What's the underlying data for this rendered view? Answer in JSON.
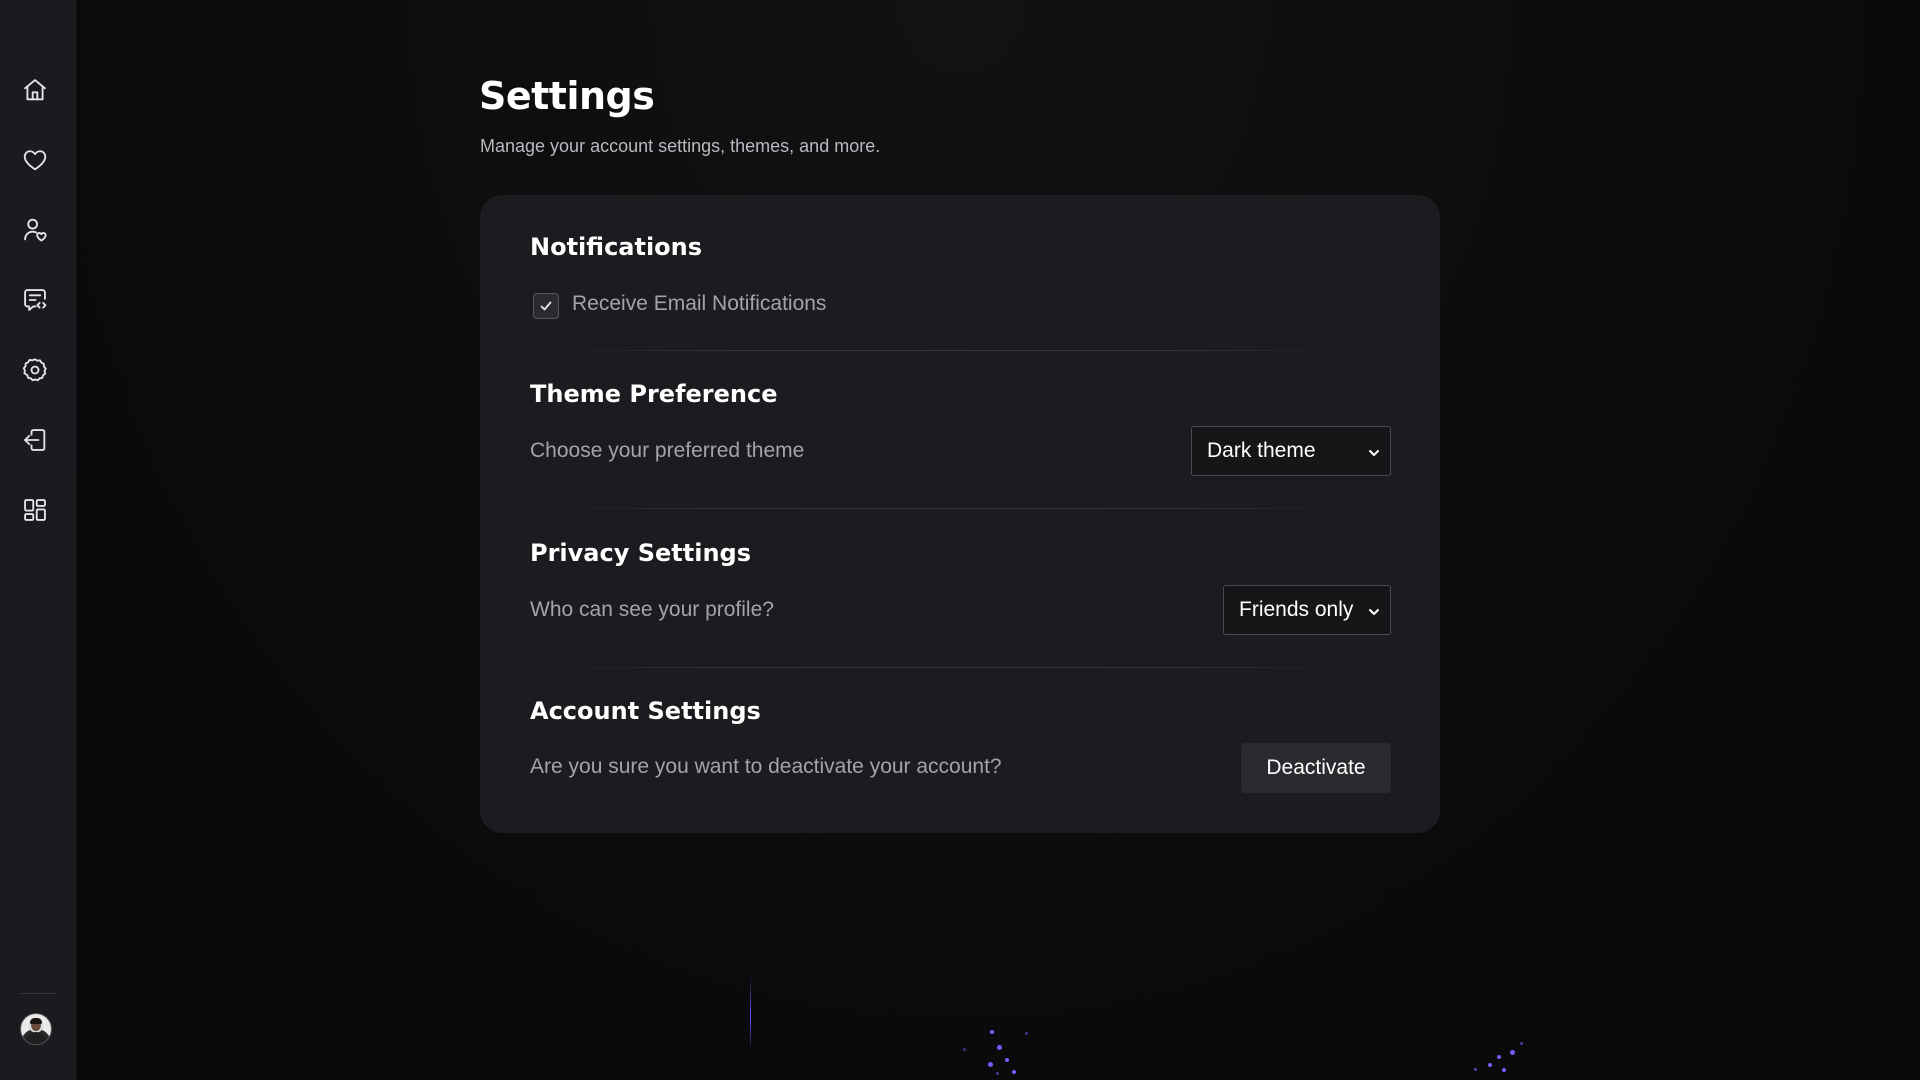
{
  "sidebar": {
    "nav_items": [
      {
        "name": "home",
        "icon": "home-icon"
      },
      {
        "name": "favorites",
        "icon": "heart-icon"
      },
      {
        "name": "friends",
        "icon": "user-heart-icon"
      },
      {
        "name": "messages",
        "icon": "message-code-icon"
      },
      {
        "name": "settings",
        "icon": "gear-icon"
      },
      {
        "name": "logout",
        "icon": "logout-icon"
      },
      {
        "name": "apps",
        "icon": "grid-icon"
      }
    ],
    "avatar_icon": "avatar"
  },
  "page": {
    "title": "Settings",
    "subtitle": "Manage your account settings, themes, and more."
  },
  "notifications": {
    "title": "Notifications",
    "email_label": "Receive Email Notifications",
    "email_checked": true
  },
  "theme": {
    "title": "Theme Preference",
    "description": "Choose your preferred theme",
    "selected": "Dark theme"
  },
  "privacy": {
    "title": "Privacy Settings",
    "description": "Who can see your profile?",
    "selected": "Friends only"
  },
  "account": {
    "title": "Account Settings",
    "description": "Are you sure you want to deactivate your account?",
    "button_label": "Deactivate"
  },
  "colors": {
    "background": "#0b0b0c",
    "sidebar": "#1a1b1e",
    "card": "#1b1c1f",
    "accent": "#7e57ff"
  }
}
